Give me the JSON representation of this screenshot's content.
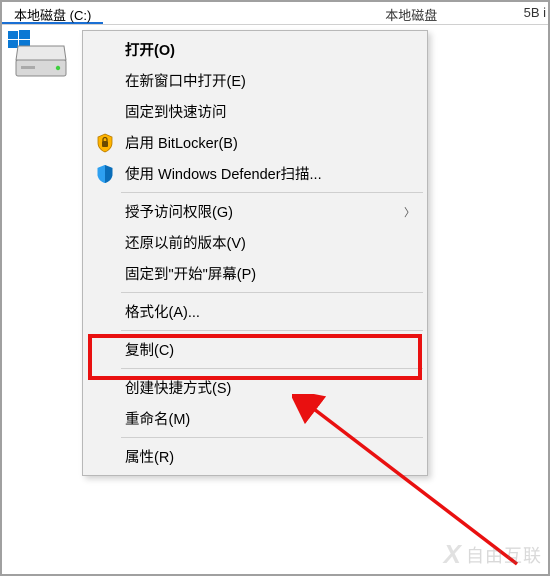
{
  "tabs": {
    "active": "本地磁盘 (C:)",
    "other": "本地磁盘"
  },
  "partial_right": "5B i",
  "menu": {
    "open": "打开(O)",
    "open_new_window": "在新窗口中打开(E)",
    "pin_quick_access": "固定到快速访问",
    "bitlocker": "启用 BitLocker(B)",
    "defender": "使用 Windows Defender扫描...",
    "grant_access": "授予访问权限(G)",
    "restore_versions": "还原以前的版本(V)",
    "pin_start": "固定到\"开始\"屏幕(P)",
    "format": "格式化(A)...",
    "copy": "复制(C)",
    "create_shortcut": "创建快捷方式(S)",
    "rename": "重命名(M)",
    "properties": "属性(R)"
  },
  "watermark": "自由互联"
}
